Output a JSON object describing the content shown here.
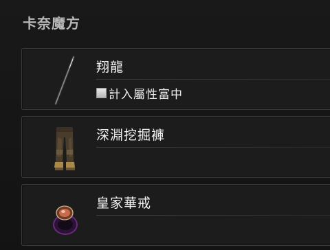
{
  "header": {
    "title": "卡奈魔方"
  },
  "items": [
    {
      "name": "翔龍",
      "icon": "spear-icon",
      "checkbox": {
        "label": "計入屬性富中",
        "checked": false
      }
    },
    {
      "name": "深淵挖掘褲",
      "icon": "pants-icon"
    },
    {
      "name": "皇家華戒",
      "icon": "ring-icon"
    }
  ]
}
